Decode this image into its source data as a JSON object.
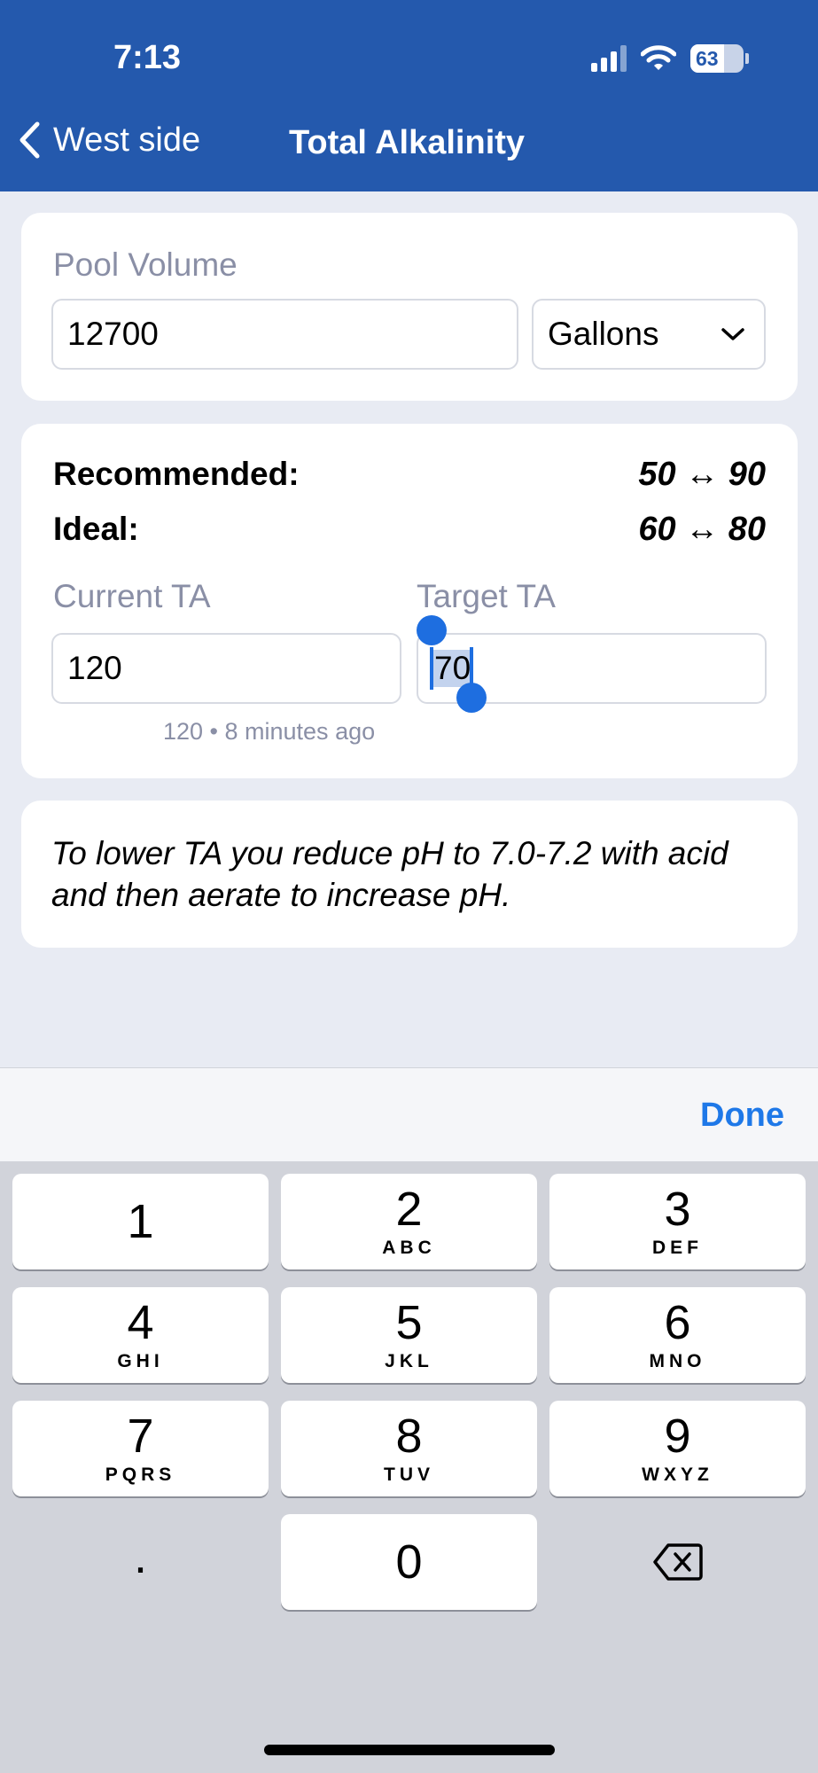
{
  "status_bar": {
    "time": "7:13",
    "battery": "63",
    "battery_level": 0.63
  },
  "nav": {
    "back_label": "West side",
    "title": "Total Alkalinity"
  },
  "pool": {
    "label": "Pool Volume",
    "volume_value": "12700",
    "unit_selected": "Gallons"
  },
  "ranges": {
    "recommended_label": "Recommended:",
    "recommended_value": "50 ↔ 90",
    "ideal_label": "Ideal:",
    "ideal_value": "60 ↔ 80"
  },
  "ta": {
    "current_label": "Current TA",
    "current_value": "120",
    "current_meta": "120 • 8 minutes ago",
    "target_label": "Target TA",
    "target_value": "70"
  },
  "tip": {
    "text": "To lower TA you reduce pH to 7.0-7.2 with acid and then aerate to increase pH."
  },
  "accessory": {
    "done_label": "Done"
  },
  "keyboard": {
    "keys": [
      {
        "digit": "1",
        "letters": ""
      },
      {
        "digit": "2",
        "letters": "ABC"
      },
      {
        "digit": "3",
        "letters": "DEF"
      },
      {
        "digit": "4",
        "letters": "GHI"
      },
      {
        "digit": "5",
        "letters": "JKL"
      },
      {
        "digit": "6",
        "letters": "MNO"
      },
      {
        "digit": "7",
        "letters": "PQRS"
      },
      {
        "digit": "8",
        "letters": "TUV"
      },
      {
        "digit": "9",
        "letters": "WXYZ"
      },
      {
        "digit": "0",
        "letters": ""
      }
    ],
    "decimal": "."
  }
}
